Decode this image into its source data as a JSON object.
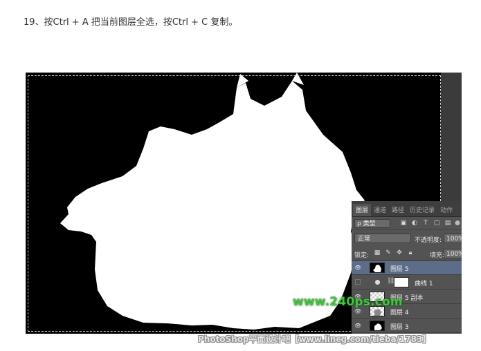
{
  "instruction": "19、按Ctrl + A 把当前图层全选，按Ctrl + C 复制。",
  "panel": {
    "tabs": [
      "图层",
      "通道",
      "路径",
      "历史记录",
      "动作"
    ],
    "filter_label": "ρ 类型",
    "blend_mode": "正常",
    "opacity_label": "不透明度:",
    "opacity_value": "100%",
    "lock_label": "锁定:",
    "fill_label": "填充:",
    "fill_value": "100%",
    "layers": [
      {
        "name": "图层 5",
        "thumb": "black",
        "selected": true,
        "visible": true
      },
      {
        "name": "曲线 1",
        "thumb": "white",
        "selected": false,
        "visible": false,
        "adjustment": true
      },
      {
        "name": "图层 5 副本",
        "thumb": "checker",
        "selected": false,
        "visible": true
      },
      {
        "name": "图层 4",
        "thumb": "checker",
        "selected": false,
        "visible": true
      },
      {
        "name": "图层 3",
        "thumb": "black",
        "selected": false,
        "visible": true
      }
    ]
  },
  "watermark_site": "www.240ps.com",
  "watermark_forum": "PhotoShop平面设计吧【www.lincg.com/tieba/1783】",
  "colors": {
    "canvas": "#000000",
    "panel_bg": "#535353",
    "selected_layer": "#5c6d89",
    "watermark_green": "#41c63b"
  },
  "icons": [
    "eye-icon",
    "chain-link-icon",
    "adjustment-circle-icon",
    "lock-icon",
    "move-icon",
    "brush-icon"
  ]
}
